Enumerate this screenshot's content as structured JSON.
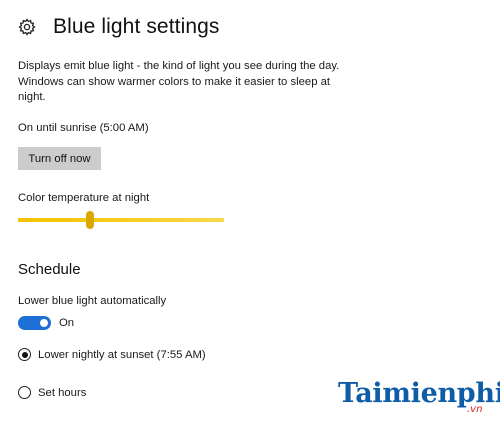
{
  "header": {
    "title": "Blue light settings",
    "icon": "gear-icon"
  },
  "description": "Displays emit blue light - the kind of light you see during the day. Windows can show warmer colors to make it easier to sleep at night.",
  "status_text": "On until sunrise (5:00 AM)",
  "turn_off_button": "Turn off now",
  "color_temperature": {
    "label": "Color temperature at night",
    "value_fraction": 0.35,
    "color": "#f3c200"
  },
  "schedule": {
    "heading": "Schedule",
    "auto_label": "Lower blue light automatically",
    "toggle_state": "On",
    "toggle_on": true,
    "toggle_color": "#1e6fd6",
    "options": [
      {
        "label": "Lower nightly at sunset (7:55 AM)",
        "selected": true
      },
      {
        "label": "Set hours",
        "selected": false
      }
    ]
  },
  "watermark": {
    "name": "Taimienphi",
    "suffix": ".vn"
  }
}
